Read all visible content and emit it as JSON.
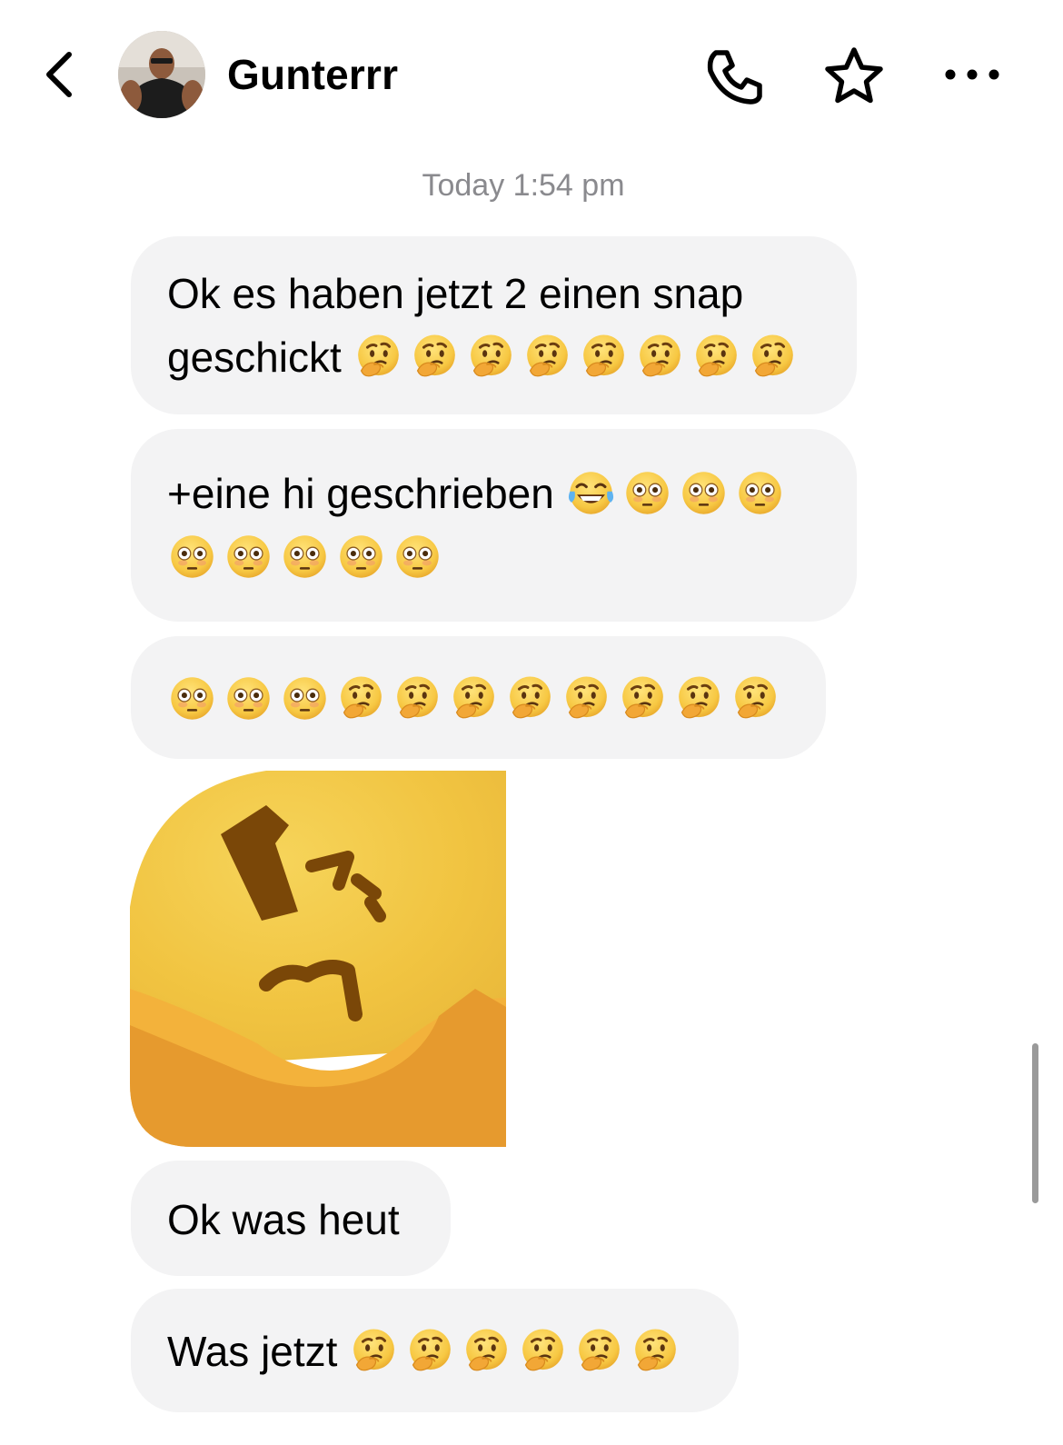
{
  "header": {
    "contact_name": "Gunterrr",
    "icons": [
      "chevron-left-icon",
      "avatar",
      "phone-icon",
      "star-icon",
      "more-dots-icon"
    ]
  },
  "conversation": {
    "timestamp": "Today 1:54 pm",
    "messages": [
      {
        "type": "text",
        "text": "Ok es haben jetzt 2 einen snap geschickt",
        "emojis": [
          "thinking",
          "thinking",
          "thinking",
          "thinking",
          "thinking",
          "thinking",
          "thinking",
          "thinking"
        ]
      },
      {
        "type": "text",
        "text": "+eine hi geschrieben",
        "emojis": [
          "joy",
          "flushed",
          "flushed",
          "flushed",
          "flushed",
          "flushed",
          "flushed",
          "flushed",
          "flushed"
        ]
      },
      {
        "type": "emoji-only",
        "emojis": [
          "flushed",
          "flushed",
          "flushed",
          "thinking",
          "thinking",
          "thinking",
          "thinking",
          "thinking",
          "thinking",
          "thinking",
          "thinking"
        ]
      },
      {
        "type": "sticker",
        "sticker": "thinking-face-sticker"
      },
      {
        "type": "text",
        "text": "Ok was heut"
      },
      {
        "type": "text",
        "text": "Was jetzt",
        "emojis": [
          "thinking",
          "thinking",
          "thinking",
          "thinking",
          "thinking",
          "thinking"
        ]
      }
    ]
  },
  "colors": {
    "bubble_bg": "#f3f3f4",
    "timestamp": "#8a8a8e",
    "emoji_yellow": "#f7c843",
    "emoji_orange": "#e89a2f"
  }
}
